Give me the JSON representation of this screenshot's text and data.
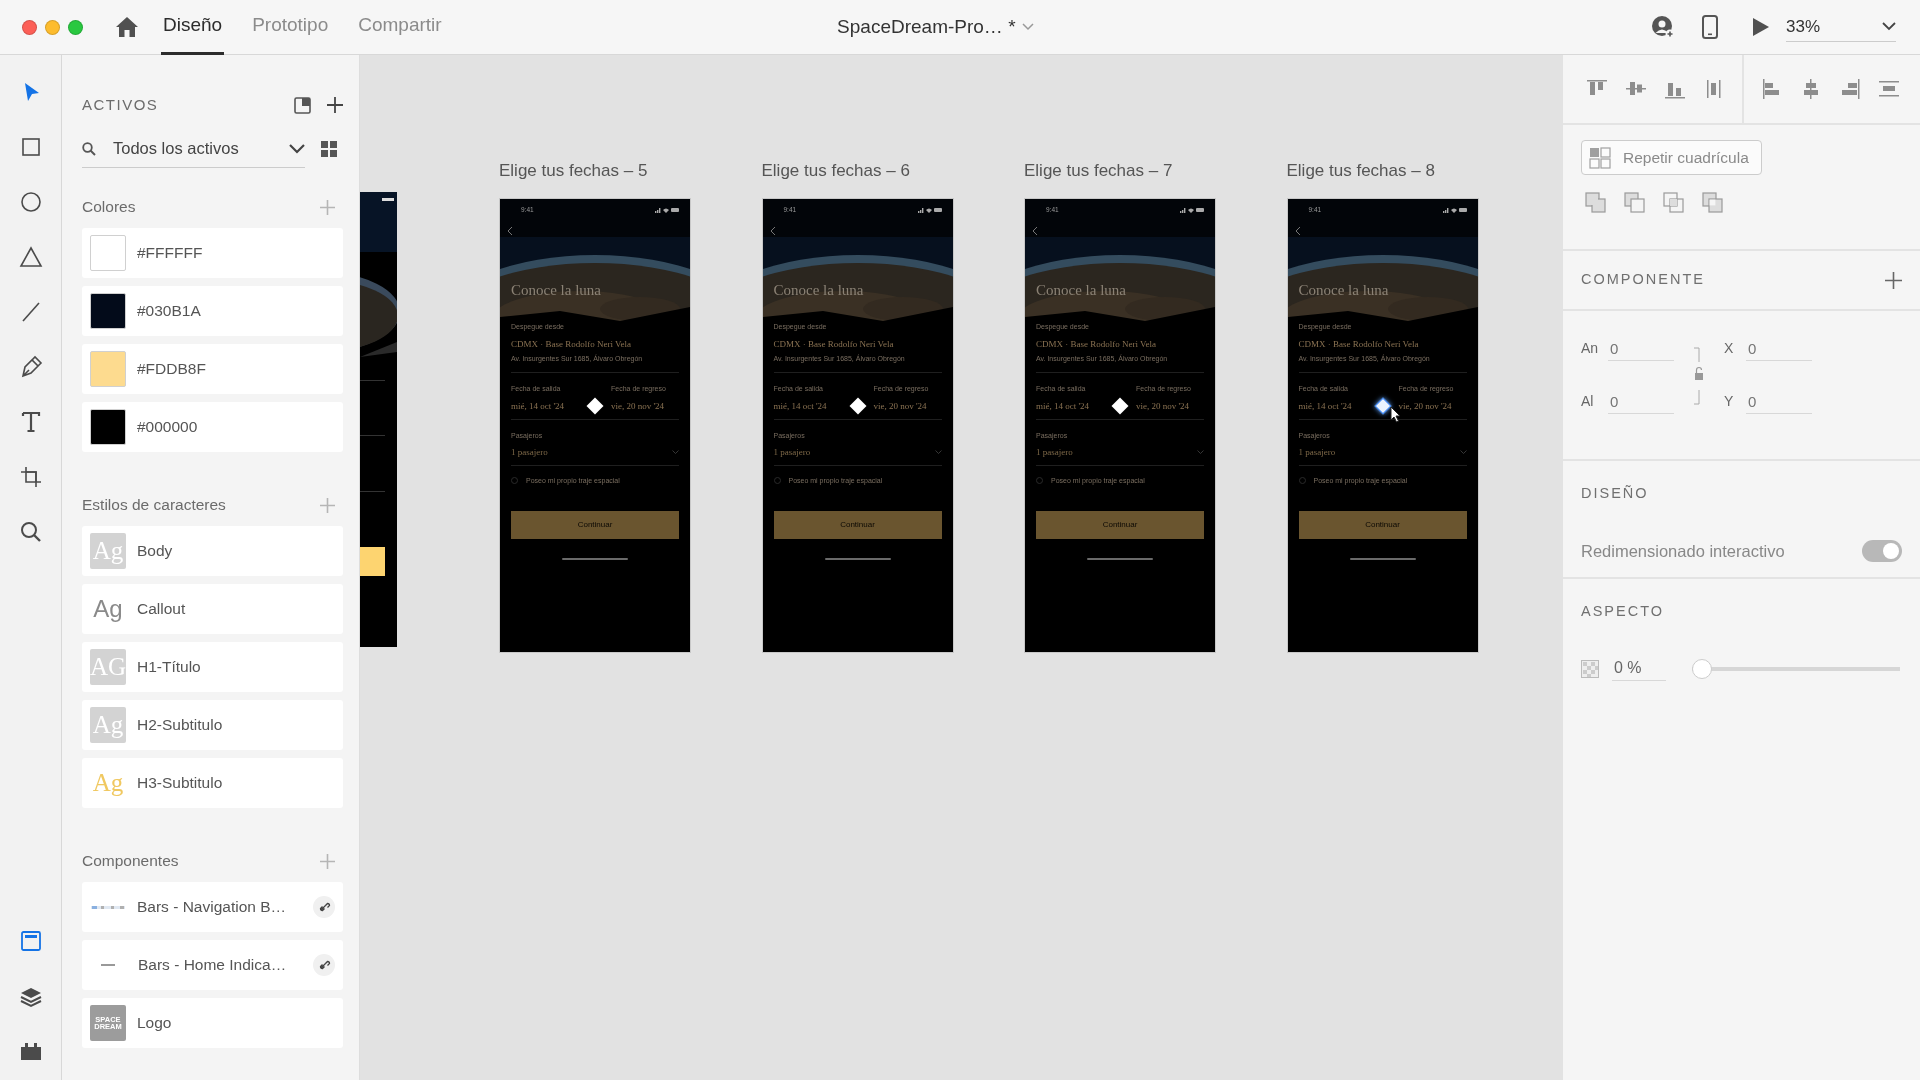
{
  "window": {
    "buttons": [
      {
        "color": "#fc5f57"
      },
      {
        "color": "#fdbc2e"
      },
      {
        "color": "#29c840"
      }
    ],
    "tabs": [
      {
        "label": "Diseño",
        "selected": true
      },
      {
        "label": "Prototipo",
        "selected": false
      },
      {
        "label": "Compartir",
        "selected": false
      }
    ],
    "document_title": "SpaceDream-Pro… *",
    "zoom": "33%"
  },
  "tools": [
    {
      "kind": "select",
      "selected": true
    },
    {
      "kind": "rectangle",
      "selected": false
    },
    {
      "kind": "ellipse",
      "selected": false
    },
    {
      "kind": "polygon",
      "selected": false
    },
    {
      "kind": "line",
      "selected": false
    },
    {
      "kind": "pen",
      "selected": false
    },
    {
      "kind": "text",
      "selected": false
    },
    {
      "kind": "artboard",
      "selected": false
    },
    {
      "kind": "zoom",
      "selected": false
    }
  ],
  "panels": [
    {
      "kind": "assets",
      "selected": true
    },
    {
      "kind": "layers",
      "selected": false
    },
    {
      "kind": "plugins",
      "selected": false
    }
  ],
  "assets": {
    "title": "ACTIVOS",
    "filter": "Todos los activos",
    "colors_title": "Colores",
    "colors": [
      {
        "label": "#FFFFFF",
        "color": "#ffffff"
      },
      {
        "label": "#030B1A",
        "color": "#030b1a"
      },
      {
        "label": "#FDDB8F",
        "color": "#fddb8f"
      },
      {
        "label": "#000000",
        "color": "#000000"
      }
    ],
    "styles_title": "Estilos de caracteres",
    "styles": [
      {
        "preview": "Ag",
        "name": "Body",
        "boxed": true,
        "kind": "serif",
        "color": "#ffffff"
      },
      {
        "preview": "Ag",
        "name": "Callout",
        "boxed": false,
        "kind": "sans",
        "color": "#8a8a8a"
      },
      {
        "preview": "AG",
        "name": "H1-Título",
        "boxed": true,
        "kind": "serif",
        "color": "#ffffff"
      },
      {
        "preview": "Ag",
        "name": "H2-Subtitulo",
        "boxed": true,
        "kind": "serif",
        "color": "#ffffff"
      },
      {
        "preview": "Ag",
        "name": "H3-Subtitulo",
        "boxed": false,
        "kind": "serif",
        "color": "#f0c860"
      }
    ],
    "components_title": "Componentes",
    "components": [
      {
        "kind": "navigation",
        "name": "Bars - Navigation B…",
        "linked": true
      },
      {
        "kind": "home",
        "name": "Bars - Home Indica…",
        "linked": true
      },
      {
        "kind": "logo",
        "thumb": "SPACE DREAM",
        "name": "Logo",
        "linked": false
      }
    ]
  },
  "artboards": [
    {
      "title": "Elige tus fechas – 5",
      "hovered": false,
      "screen": {
        "time": "9:41",
        "heading": "Conoce la luna",
        "origin_label": "Despegue desde",
        "origin": "CDMX · Base Rodolfo Neri Vela",
        "address": "Av. Insurgentes Sur 1685, Álvaro Obregón",
        "departure_label": "Fecha de salida",
        "departure": "mié, 14 oct '24",
        "return_label": "Fecha de regreso",
        "return": "vie, 20 nov '24",
        "passengers_label": "Pasajeros",
        "passengers": "1 pasajero",
        "suit_label": "Poseo mi propio traje espacial",
        "suit_checked": false,
        "button": "Continuar"
      }
    },
    {
      "title": "Elige tus fechas – 6",
      "hovered": false,
      "screen": {
        "time": "9:41",
        "heading": "Conoce la luna",
        "origin_label": "Despegue desde",
        "origin": "CDMX · Base Rodolfo Neri Vela",
        "address": "Av. Insurgentes Sur 1685, Álvaro Obregón",
        "departure_label": "Fecha de salida",
        "departure": "mié, 14 oct '24",
        "return_label": "Fecha de regreso",
        "return": "vie, 20 nov '24",
        "passengers_label": "Pasajeros",
        "passengers": "1 pasajero",
        "suit_label": "Poseo mi propio traje espacial",
        "suit_checked": false,
        "button": "Continuar"
      }
    },
    {
      "title": "Elige tus fechas – 7",
      "hovered": false,
      "screen": {
        "time": "9:41",
        "heading": "Conoce la luna",
        "origin_label": "Despegue desde",
        "origin": "CDMX · Base Rodolfo Neri Vela",
        "address": "Av. Insurgentes Sur 1685, Álvaro Obregón",
        "departure_label": "Fecha de salida",
        "departure": "mié, 14 oct '24",
        "return_label": "Fecha de regreso",
        "return": "vie, 20 nov '24",
        "passengers_label": "Pasajeros",
        "passengers": "1 pasajero",
        "suit_label": "Poseo mi propio traje espacial",
        "suit_checked": false,
        "button": "Continuar"
      }
    },
    {
      "title": "Elige tus fechas – 8",
      "hovered": true,
      "screen": {
        "time": "9:41",
        "heading": "Conoce la luna",
        "origin_label": "Despegue desde",
        "origin": "CDMX · Base Rodolfo Neri Vela",
        "address": "Av. Insurgentes Sur 1685, Álvaro Obregón",
        "departure_label": "Fecha de salida",
        "departure": "mié, 14 oct '24",
        "return_label": "Fecha de regreso",
        "return": "vie, 20 nov '24",
        "passengers_label": "Pasajeros",
        "passengers": "1 pasajero",
        "suit_label": "Poseo mi propio traje espacial",
        "suit_checked": false,
        "button": "Continuar"
      }
    }
  ],
  "inspector": {
    "repeat_grid": "Repetir cuadrícula",
    "component_title": "COMPONENTE",
    "fields": [
      {
        "label": "An",
        "placeholder": "0"
      },
      {
        "label": "X",
        "placeholder": "0"
      },
      {
        "label": "Al",
        "placeholder": "0"
      },
      {
        "label": "Y",
        "placeholder": "0"
      }
    ],
    "layout_title": "DISEÑO",
    "responsive": {
      "label": "Redimensionado interactivo",
      "on": true,
      "disabled": true
    },
    "appearance_title": "ASPECTO",
    "opacity": {
      "value": "0 %",
      "level": 0
    }
  }
}
